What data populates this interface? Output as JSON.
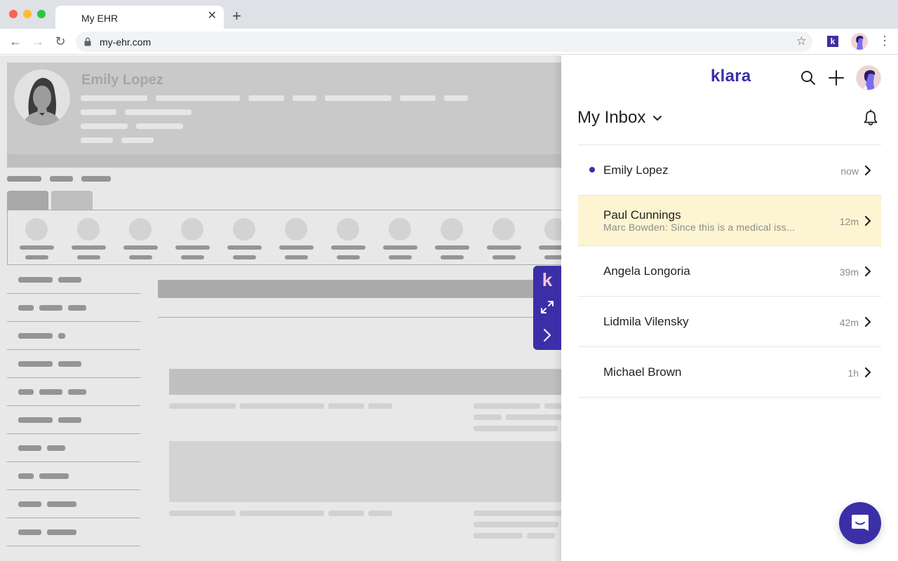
{
  "browser": {
    "tab_title": "My EHR",
    "url": "my-ehr.com",
    "extension_label": "k",
    "icons": {
      "back": "arrow-left-icon",
      "forward": "arrow-right-icon",
      "reload": "reload-icon",
      "lock": "lock-icon",
      "bookmark": "star-icon",
      "menu": "more-vertical-icon",
      "new_tab": "plus-icon",
      "close_tab": "close-icon"
    },
    "glyphs": {
      "close": "✕",
      "new_tab": "+",
      "back": "←",
      "forward": "→",
      "reload": "↻",
      "star": "☆",
      "menu": "⋮"
    }
  },
  "ehr": {
    "patient_name": "Emily Lopez"
  },
  "klara_tab": {
    "logo_letter": "k",
    "icons": [
      "expand-icon",
      "collapse-chevron-icon"
    ]
  },
  "panel": {
    "logo": "klara",
    "brand_color": "#3b2fa8",
    "inbox_title": "My Inbox",
    "icons": [
      "search-icon",
      "plus-icon",
      "user-avatar",
      "chevron-down-icon",
      "bell-icon",
      "chat-launcher-icon"
    ],
    "conversations": [
      {
        "name": "Emily Lopez",
        "preview": "",
        "time": "now",
        "unread": true,
        "highlighted": false
      },
      {
        "name": "Paul Cunnings",
        "preview": "Marc Bowden: Since this is a medical iss...",
        "time": "12m",
        "unread": false,
        "highlighted": true
      },
      {
        "name": "Angela Longoria",
        "preview": "",
        "time": "39m",
        "unread": false,
        "highlighted": false
      },
      {
        "name": "Lidmila Vilensky",
        "preview": "",
        "time": "42m",
        "unread": false,
        "highlighted": false
      },
      {
        "name": "Michael Brown",
        "preview": "",
        "time": "1h",
        "unread": false,
        "highlighted": false
      }
    ]
  }
}
